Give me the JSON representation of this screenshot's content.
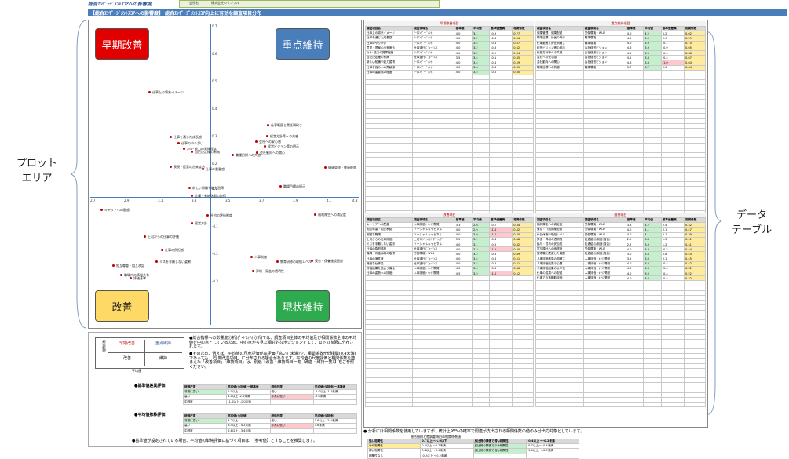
{
  "header": {
    "title": "総合ｴﾝｹﾞｰｼﾞﾒﾝﾄｽｺｱへの影響度",
    "field_label": "会社名",
    "field_value": "株式会社Ｏサンプル"
  },
  "banner": "【総合ｴﾝｹﾞｰｼﾞﾒﾝﾄｽｺｱへの影響度】 総合ｴﾝｹﾞｰｼﾞﾒﾝﾄｽｺｱ向上に有効な調査項目分布",
  "quadrants": {
    "early": "早期改善",
    "focus": "重点維持",
    "improve": "改善",
    "maintain": "現状維持"
  },
  "colors": {
    "early": "#e00000",
    "focus": "#4a7ebb",
    "improve": "#ffd966",
    "maintain": "#2eab4f"
  },
  "callouts": {
    "plot": "プロット\nエリア",
    "table": "データ\nテーブル"
  },
  "axis": {
    "x_ticks": [
      "2.7",
      "2.9",
      "3.1",
      "3.3",
      "3.5",
      "3.7",
      "3.9",
      "4.1",
      "4.3"
    ],
    "y_ticks": [
      "0.7",
      "0.6",
      "0.5",
      "0.4",
      "0.3",
      "0.2",
      "0.1",
      "-0.1",
      "-0.2",
      "-0.3"
    ]
  },
  "points": [
    {
      "label": "仕事上の将来イメージ"
    },
    {
      "label": "仕事範囲と責任明確さ"
    },
    {
      "label": "仕事を通じた成長感"
    },
    {
      "label": "仕事のやりがい"
    },
    {
      "label": "経営方針等への共感"
    },
    {
      "label": "会社への安心感"
    },
    {
      "label": "ｽｷﾙ・能力の発揮程度"
    },
    {
      "label": "経営ビジョン等の明示"
    },
    {
      "label": "自己決定権の有無"
    },
    {
      "label": "会社動向への関心"
    },
    {
      "label": "職種目標への共感"
    },
    {
      "label": "表現・提案の出来度合"
    },
    {
      "label": "仕事の重要感"
    },
    {
      "label": "健康管理・健康配慮"
    },
    {
      "label": "新しい知識や能力習得"
    },
    {
      "label": "職場目標の明示"
    },
    {
      "label": "会議・有給休暇の取得"
    },
    {
      "label": "キャリアへの配慮"
    },
    {
      "label": "福利厚生への満足度"
    },
    {
      "label": "社内の評価制度"
    },
    {
      "label": "上司からの仕事の評価"
    },
    {
      "label": "東京・保養施設配慮"
    },
    {
      "label": "仕事の負担感"
    },
    {
      "label": "人事制度"
    },
    {
      "label": "教育研修の取組レベル"
    },
    {
      "label": "相互尊重・相互承認"
    },
    {
      "label": "ミスを非難しない姿勢"
    },
    {
      "label": "昇格・昇進の透明性"
    },
    {
      "label": "評価基準"
    },
    {
      "label": "職場内の情報共有"
    },
    {
      "label": "経営方針"
    }
  ],
  "legend": {
    "mini": {
      "early": "早期改善",
      "focus": "重点維持",
      "improve": "改善",
      "maintain": "維持",
      "yaxis": "相関係数",
      "xaxis": "平均値"
    },
    "note1": "●総合指標への影響度分析(ﾎﾟｰﾄﾌｫﾘｵ分析)では、調査項目全体の平均値及び相関係数全体の平均値を中心点としているため、中心点から見た相対的なポジションとして、以下の象限に分布されます。",
    "note2": "●そのため、例えば、平均値の尺度評価が高評価(「高い」未満)や、相関係数が低相関(0.4未満)であっても、「早期改善項目」に分布される場合があります。平均値の尺度評価と相関係数を踏まえた「改善項目」「維持項目」は、別紙【改善・維持項目一覧（改善・維持一覧）】をご参照ください。",
    "scale1_title": "●基準値差異評価",
    "scale1_rows": [
      [
        "評価尺度",
        "平均値(今回値)ー基準値",
        "評価尺度",
        "平均値(今回値)ー基準値"
      ],
      [
        "非常に高い",
        "2.0以上",
        "低い",
        "-2.0以上 -1.0未満"
      ],
      [
        "高い",
        "1.0以上 -2.0未満",
        "非常に低い",
        "-2.0未満"
      ],
      [
        "中程度",
        "-1.0以上 -1.0未満",
        "",
        ""
      ]
    ],
    "scale2_title": "●平均値推移評価",
    "scale2_rows": [
      [
        "評価尺度",
        "平均値(今回値)",
        "評価尺度",
        "平均値(今回値)"
      ],
      [
        "非常に高い",
        "4.2以上",
        "低い",
        "1.6以上 - 2.6未満"
      ],
      [
        "高い",
        "3.4以上 - 4.2未満",
        "非常に低い",
        "1.6未満"
      ],
      [
        "中程度",
        "2.6以上 - 3.4未満",
        "",
        ""
      ]
    ],
    "footnote": "●基準値が設定されている場合、平均値の単純評価に基づく項目は、【参考値】とすることを推奨します。"
  },
  "tables": {
    "headers": [
      "調査項目名",
      "調査領域名",
      "基準値",
      "平均値",
      "基準値差異",
      "相関係数"
    ],
    "sect_early": "早期改善項目",
    "sect_focus": "重点維持項目",
    "sect_improve": "改善項目",
    "sect_maintain": "維持項目",
    "early_rows": [
      [
        "仕事上の将来イメージ",
        "ﾜｰｸｴﾝｹﾞｰｼﾞﾒﾝﾄ",
        "4.0",
        "3.1",
        "-0.9",
        "0.77"
      ],
      [
        "仕事を通じた成長感",
        "ﾜｰｸｴﾝｹﾞｰｼﾞﾒﾝﾄ",
        "4.0",
        "3.2",
        "-0.8",
        "0.64"
      ],
      [
        "仕事のやりがい",
        "ﾜｰｸｴﾝｹﾞｰｼﾞﾒﾝﾄ",
        "4.0",
        "3.4",
        "-0.6",
        "0.67"
      ],
      [
        "意見・提案の出来度合",
        "仕事遂行ﾊﾟﾌｫｰﾏﾝｽ",
        "4.0",
        "3.2",
        "-0.8",
        "0.62"
      ],
      [
        "ｽｷﾙ・能力の発揮程度",
        "ﾜｰｸｴﾝｹﾞｰｼﾞﾒﾝﾄ",
        "4.0",
        "3.2",
        "-0.2",
        "0.64"
      ],
      [
        "自己決定権の有無",
        "仕事遂行ﾊﾟﾌｫｰﾏﾝｽ",
        "3.5",
        "3.4",
        "-0.1",
        "0.65"
      ],
      [
        "新しい知識や能力習得",
        "ﾜｰｸｴﾝｹﾞｰｼﾞﾒﾝﾄ",
        "4.0",
        "3.4",
        "-0.6",
        "0.59"
      ],
      [
        "仕事を強みへの貢献感",
        "ﾜｰｸｴﾝｹﾞｰｼﾞﾒﾝﾄ",
        "4.0",
        "3.6",
        "-0.4",
        "0.61"
      ],
      [
        "仕事の重要感の程度",
        "ﾜｰｸｴﾝｹﾞｰｼﾞﾒﾝﾄ",
        "4.0",
        "3.5",
        "-0.5",
        "0.60"
      ]
    ],
    "focus_rows": [
      [
        "健康管理・健康配慮",
        "労働環境・WLB",
        "4.0",
        "4.2",
        "0.2",
        "0.62"
      ],
      [
        "職場目標・計画の明示",
        "職場環境",
        "4.0",
        "3.9",
        "0.9",
        "0.59"
      ],
      [
        "仕事範囲と責任明確さ",
        "職場環境",
        "4.0",
        "3.9",
        "-0.1",
        "0.70"
      ],
      [
        "経営ビジョン等の明示",
        "会社経営ビジョン",
        "4.8",
        "3.9",
        "-0.9",
        "0.65"
      ],
      [
        "経営方針等への共感",
        "会社経営ビジョン",
        "4.3",
        "3.9",
        "-0.4",
        "0.68"
      ],
      [
        "会社への安心感",
        "会社経営ビジョン",
        "4.2",
        "3.8",
        "-0.4",
        "0.67"
      ],
      [
        "会社動向への関心",
        "会社経営ビジョン",
        "4.8",
        "3.8",
        "-1.0",
        "0.64"
      ],
      [
        "職場目標への共感",
        "職場環境",
        "3.7",
        "3.7",
        "0.0",
        "0.64"
      ]
    ],
    "improve_rows": [
      [
        "キャリアへの配慮",
        "人事評価・ｷｬﾘｱ開発",
        "3.3",
        "2.6",
        "-0.7",
        "0.34"
      ],
      [
        "相互尊重・相互承認",
        "ソーシャルキャピタル",
        "4.0",
        "2.9",
        "-1.6",
        "0.42"
      ],
      [
        "謝辞な職場",
        "ソーシャルキャピタル",
        "4.0",
        "3.0",
        "-1.0",
        "0.40"
      ],
      [
        "上司からの仕事評価",
        "上司ﾏﾈｼﾞﾒﾝﾄ/ﾘｰﾀﾞｰｼｯﾌﾟ",
        "3.5",
        "3.1",
        "-0.4",
        "0.48"
      ],
      [
        "ミスを非難しない姿勢",
        "ソーシャルキャピタル",
        "4.0",
        "3.1",
        "-0.9",
        "0.42"
      ],
      [
        "仕事の負担感度",
        "仕事遂行ﾊﾟﾌｫｰﾏﾝｽ",
        "4.0",
        "3.3",
        "-1.2",
        "0.45"
      ],
      [
        "職場・有給休暇の取得",
        "労働環境・WLB",
        "4.0",
        "3.2",
        "-0.8",
        "0.49"
      ],
      [
        "仕事の適性度",
        "仕事遂行ﾊﾟﾌｫｰﾏﾝｽ",
        "4.0",
        "3.4",
        "-0.6",
        "0.51"
      ],
      [
        "適度な仕事量",
        "仕事遂行ﾊﾟﾌｫｰﾏﾝｽ",
        "4.0",
        "3.4",
        "-0.6",
        "0.51"
      ],
      [
        "評価結果を話合う機会",
        "人事評価・ｷｬﾘｱ開発",
        "4.0",
        "3.4",
        "-0.6",
        "0.46"
      ],
      [
        "仕事の姿勢への評価",
        "人事評価・ｷｬﾘｱ開発",
        "4.5",
        "3.5",
        "-1.0",
        "0.52"
      ]
    ],
    "maintain_rows": [
      [
        "福利厚生への満足度",
        "労働環境・WLB",
        "3.8",
        "4.2",
        "0.4",
        "0.32"
      ],
      [
        "東京・介護開業配慮",
        "労働環境・WLB",
        "4.0",
        "4.1",
        "0.1",
        "0.47"
      ],
      [
        "休日休暇の取組レベル",
        "労働環境・WLB",
        "4.0",
        "4.1",
        "0.1",
        "0.39"
      ],
      [
        "昇進・昇格の透明性",
        "処遇給与/制度(賃金)",
        "2.9",
        "3.8",
        "1.3",
        "0.41"
      ],
      [
        "給与・賞与の妥当性",
        "処遇給与/制度(賃金)",
        "2.7",
        "3.9",
        "1.2",
        "0.41"
      ],
      [
        "賞与額分への納得度",
        "労働環境・WLB",
        "4.0",
        "3.8",
        "-0.2",
        "0.44"
      ],
      [
        "管理職に配慮した報酬",
        "処遇給与/制度(賃金)",
        "3.0",
        "3.8",
        "0.8",
        "0.44"
      ],
      [
        "人事評価基準の明確さ",
        "人事評価・ｷｬﾘｱ開発",
        "3.5",
        "3.6",
        "0.1",
        "0.45"
      ],
      [
        "人事評価結果の公開",
        "人事評価・ｷｬﾘｱ開発",
        "4.0",
        "3.6",
        "-0.4",
        "0.42"
      ],
      [
        "人事評価結果の公平性",
        "人事評価・ｷｬﾘｱ開発",
        "4.0",
        "3.6",
        "-0.4",
        "0.52"
      ],
      [
        "仕事の成果への配慮",
        "人事評価・ｷｬﾘｱ開発",
        "4.0",
        "3.6",
        "-0.4",
        "0.52"
      ],
      [
        "仕事での有職取評価",
        "人事評価・ｷｬﾘｱ開発",
        "4.0",
        "3.6",
        "-0.4",
        "0.32"
      ]
    ]
  },
  "bottom": {
    "note": "● 分析には相関係数を使用していますが、統計上95%の確率で関連が支出される相関係数の値のみ分出力対象としています。",
    "corr_title": "総合指標と各調査項目の相関係数値",
    "corr_rows": [
      [
        "強い相関性",
        "0.7以上 ～1.0以下",
        "反比例の関係で弱い相関性",
        "-0.4以上 ～-0.2未満"
      ],
      [
        "やや相関性",
        "0.4以上 ～0.7未満",
        "反比例の関係でやや相関性",
        "-0.7以上 ～-0.4未満"
      ],
      [
        "弱い相関性",
        "0.2以上 ～0.4未満",
        "反比例の関係で強い相関性",
        "-1.0以上 ～-0.7未満"
      ],
      [
        "相関性なし",
        "-0.2以上 ～0.2未満",
        "",
        ""
      ]
    ]
  }
}
